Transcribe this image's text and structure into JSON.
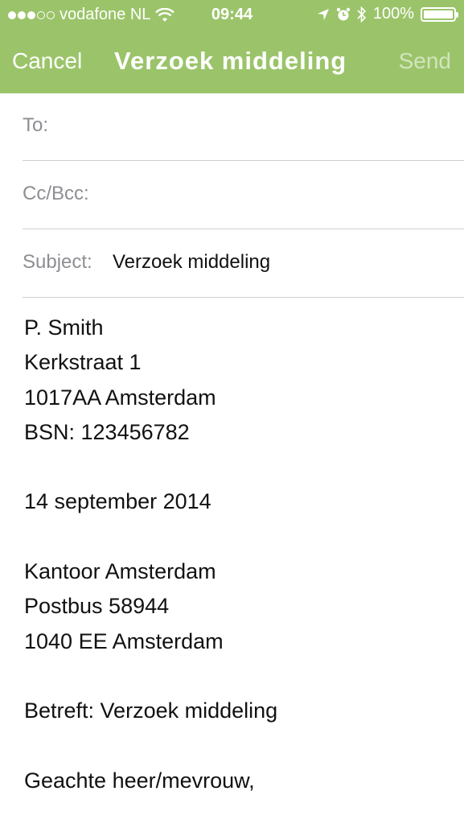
{
  "status": {
    "carrier": "vodafone NL",
    "time": "09:44",
    "battery": "100%"
  },
  "nav": {
    "cancel": "Cancel",
    "title": "Verzoek middeling",
    "send": "Send"
  },
  "fields": {
    "to_label": "To:",
    "cc_label": "Cc/Bcc:",
    "subject_label": "Subject:",
    "subject_value": "Verzoek middeling"
  },
  "body": {
    "lines": [
      "P. Smith",
      "Kerkstraat 1",
      "1017AA Amsterdam",
      "BSN: 123456782",
      "",
      "14 september 2014",
      "",
      "Kantoor Amsterdam",
      "Postbus 58944",
      "1040 EE Amsterdam",
      "",
      "Betreft: Verzoek middeling",
      "",
      "Geachte heer/mevrouw,"
    ]
  }
}
